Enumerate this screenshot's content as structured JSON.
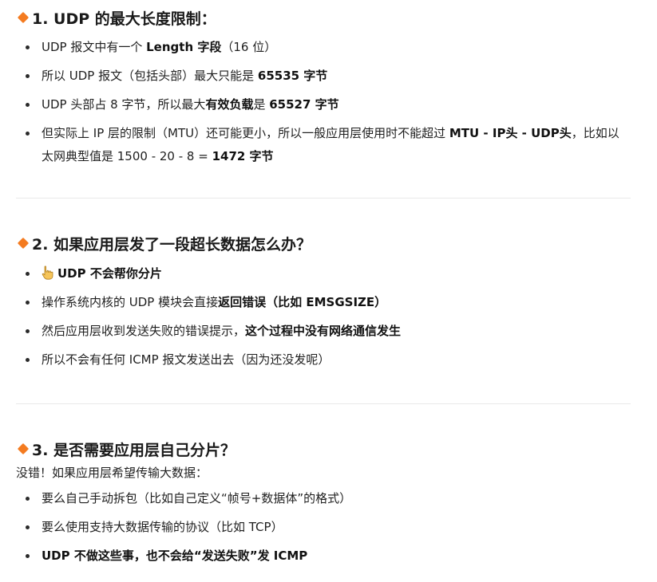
{
  "section1": {
    "heading": "1. UDP 的最大长度限制：",
    "item1": {
      "a": "UDP 报文中有一个 ",
      "b": "Length 字段",
      "c": "（16 位）"
    },
    "item2": {
      "a": "所以 UDP 报文（包括头部）最大只能是 ",
      "b": "65535 字节"
    },
    "item3": {
      "a": "UDP 头部占 8 字节，所以最大",
      "b": "有效负载",
      "c": "是 ",
      "d": "65527 字节"
    },
    "item4": {
      "a": "但实际上 IP 层的限制（MTU）还可能更小，所以一般应用层使用时不能超过 ",
      "b": "MTU - IP头 - UDP头",
      "c": "，比如以太网典型值是 1500 - 20 - 8 = ",
      "d": "1472 字节"
    }
  },
  "section2": {
    "heading": "2. 如果应用层发了一段超长数据怎么办？",
    "item1": {
      "icon": "pointing-hand-icon",
      "b": "UDP 不会帮你分片"
    },
    "item2": {
      "a": "操作系统内核的 UDP 模块会直接",
      "b": "返回错误（比如 EMSGSIZE）"
    },
    "item3": {
      "a": "然后应用层收到发送失败的错误提示，",
      "b": "这个过程中没有网络通信发生"
    },
    "item4": {
      "a": "所以不会有任何 ICMP 报文发送出去（因为还没发呢）"
    }
  },
  "section3": {
    "heading": "3. 是否需要应用层自己分片？",
    "intro": "没错！如果应用层希望传输大数据：",
    "item1": {
      "a": "要么自己手动拆包（比如自己定义“帧号+数据体”的格式）"
    },
    "item2": {
      "a": "要么使用支持大数据传输的协议（比如 TCP）"
    },
    "item3": {
      "b": "UDP 不做这些事，也不会给“发送失败”发 ICMP"
    }
  },
  "colors": {
    "accent": "#f47b20",
    "text": "#1f1f1f",
    "divider": "#e9e9e9"
  }
}
